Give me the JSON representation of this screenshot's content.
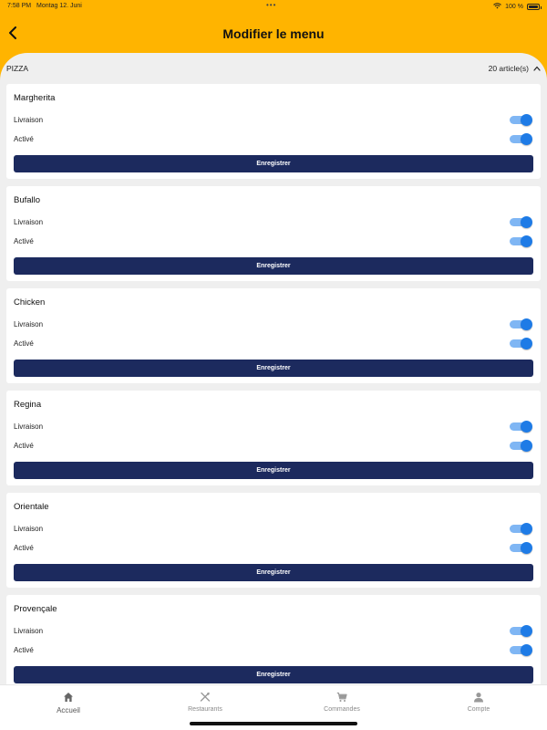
{
  "status_bar": {
    "time": "7:58 PM",
    "date": "Montag 12. Juni",
    "battery": "100 %"
  },
  "header": {
    "title": "Modifier le menu",
    "back_icon": "chevron-left-icon"
  },
  "section": {
    "name": "PIZZA",
    "count": "20 article(s)",
    "expanded": true
  },
  "labels": {
    "delivery": "Livraison",
    "active": "Activé",
    "save": "Enregistrer"
  },
  "items": [
    {
      "name": "Margherita",
      "delivery": true,
      "active": true
    },
    {
      "name": "Bufallo",
      "delivery": true,
      "active": true
    },
    {
      "name": "Chicken",
      "delivery": true,
      "active": true
    },
    {
      "name": "Regina",
      "delivery": true,
      "active": true
    },
    {
      "name": "Orientale",
      "delivery": true,
      "active": true
    },
    {
      "name": "Provençale",
      "delivery": true,
      "active": true
    }
  ],
  "tab_bar": [
    {
      "label": "Accueil",
      "icon": "home-icon",
      "active": true
    },
    {
      "label": "Restaurants",
      "icon": "utensils-icon",
      "active": false
    },
    {
      "label": "Commandes",
      "icon": "cart-icon",
      "active": false
    },
    {
      "label": "Compte",
      "icon": "user-icon",
      "active": false
    }
  ],
  "colors": {
    "header_bg": "#ffb400",
    "button_bg": "#1c2a5e",
    "toggle_on": "#1e7be6",
    "page_bg": "#efefef"
  }
}
